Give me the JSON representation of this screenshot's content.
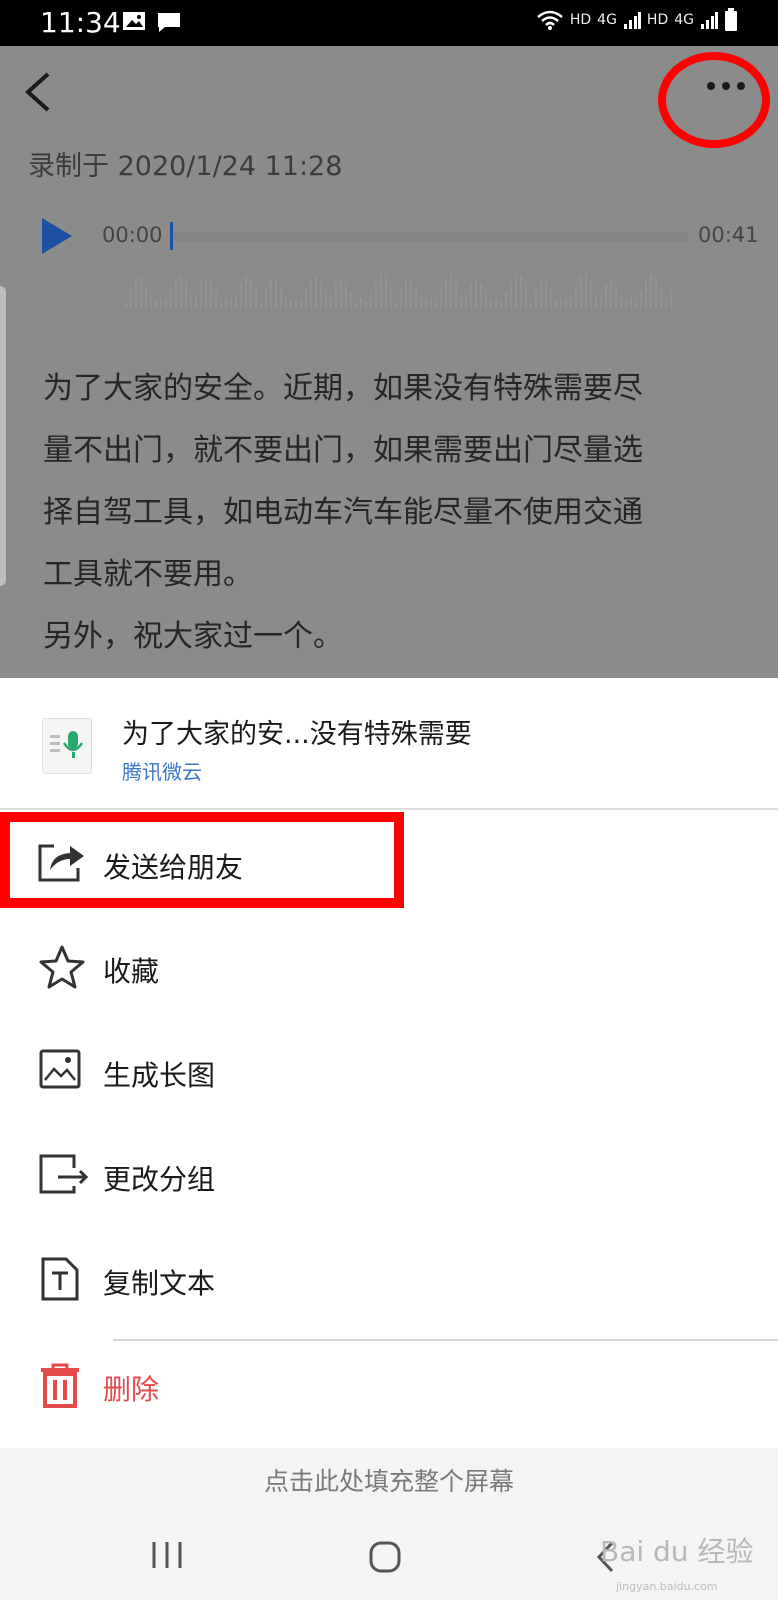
{
  "status_bar": {
    "time": "11:34",
    "network": [
      "HD",
      "4G",
      "HD",
      "4G"
    ]
  },
  "header": {
    "recorded": "录制于 2020/1/24 11:28"
  },
  "player": {
    "start_time": "00:00",
    "end_time": "00:41"
  },
  "transcript": {
    "lines": [
      "为了大家的安全。近期，如果没有特殊需要尽",
      "量不出门，就不要出门，如果需要出门尽量选",
      "择自驾工具，如电动车汽车能尽量不使用交通",
      "工具就不要用。",
      "另外，祝大家过一个。"
    ]
  },
  "sheet": {
    "card_title": "为了大家的安...没有特殊需要",
    "card_source": "腾讯微云",
    "items": [
      {
        "label": "发送给朋友",
        "icon": "share-icon"
      },
      {
        "label": "收藏",
        "icon": "star-icon"
      },
      {
        "label": "生成长图",
        "icon": "image-icon"
      },
      {
        "label": "更改分组",
        "icon": "move-group-icon"
      },
      {
        "label": "复制文本",
        "icon": "text-icon"
      },
      {
        "label": "删除",
        "icon": "trash-icon"
      }
    ],
    "delete_color": "#e34a4a"
  },
  "fill_screen": {
    "label": "点击此处填充整个屏幕"
  },
  "watermark": {
    "brand": "Bai du 经验",
    "url": "jingyan.baidu.com"
  },
  "colors": {
    "annotation_red": "#ff0000",
    "link_blue": "#3a78c8",
    "play_blue": "#1f4fa3"
  }
}
